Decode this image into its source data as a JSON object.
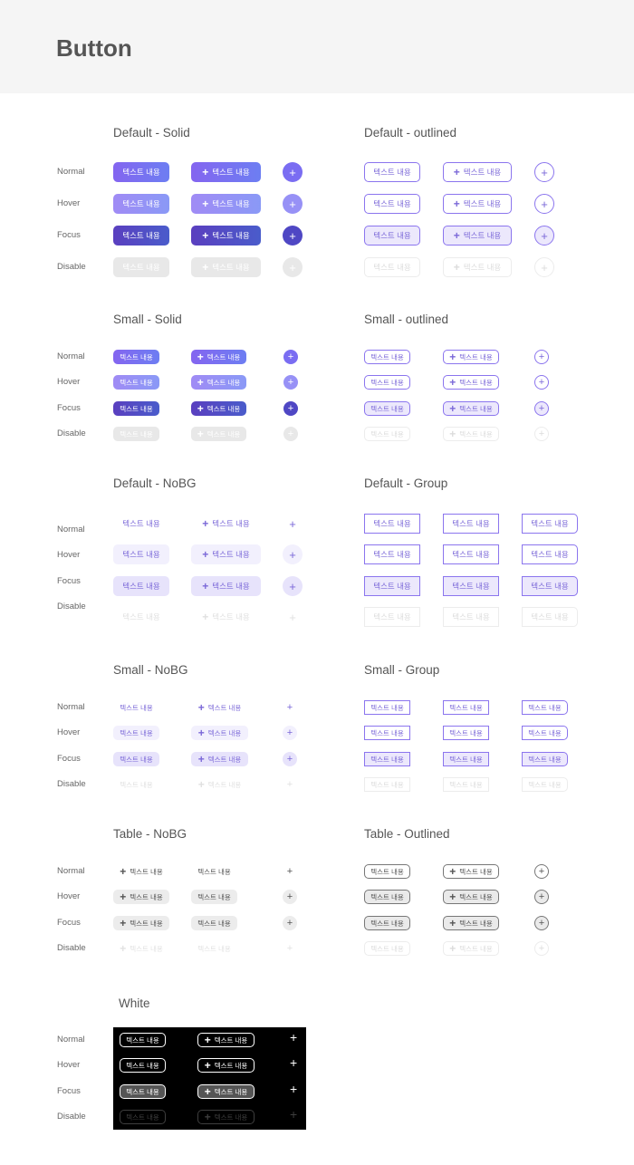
{
  "page": {
    "title": "Button"
  },
  "states": {
    "normal": "Normal",
    "hover": "Hover",
    "focus": "Focus",
    "disable": "Disable"
  },
  "button": {
    "text": "텍스트 내용",
    "plus": "+"
  },
  "sections": {
    "default_solid": "Default - Solid",
    "default_outlined": "Default - outlined",
    "small_solid": "Small - Solid",
    "small_outlined": "Small - outlined",
    "default_nobg": "Default - NoBG",
    "default_group": "Default - Group",
    "small_nobg": "Small - NoBG",
    "small_group": "Small - Group",
    "table_nobg": "Table - NoBG",
    "table_outlined": "Table - Outlined",
    "white": "White"
  },
  "colors": {
    "primary": "#8465f0",
    "primary_hover": "#a08bf5",
    "primary_focus": "#5a3fbf",
    "disabled": "#e8e8e8",
    "outline": "#8b75ee",
    "focus_bg": "#ece8fc",
    "table_border": "#777777",
    "white_panel": "#000000"
  }
}
